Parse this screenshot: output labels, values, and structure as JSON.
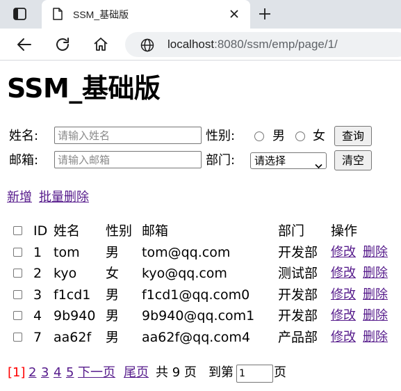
{
  "browser": {
    "tab_title": "SSM_基础版",
    "url_host": "localhost",
    "url_path": ":8080/ssm/emp/page/1/"
  },
  "page": {
    "title": "SSM_基础版",
    "search": {
      "name_label": "姓名:",
      "name_placeholder": "请输入姓名",
      "gender_label": "性别:",
      "gender_male": "男",
      "gender_female": "女",
      "query_button": "查询",
      "email_label": "邮箱:",
      "email_placeholder": "请输入邮箱",
      "dept_label": "部门:",
      "dept_selected": "请选择",
      "clear_button": "清空"
    },
    "actions": {
      "add": "新增",
      "batch_delete": "批量删除"
    },
    "table": {
      "headers": [
        "ID",
        "姓名",
        "性别",
        "邮箱",
        "部门",
        "操作"
      ],
      "edit_label": "修改",
      "delete_label": "删除",
      "rows": [
        {
          "id": "1",
          "name": "tom",
          "gender": "男",
          "email": "tom@qq.com",
          "dept": "开发部"
        },
        {
          "id": "2",
          "name": "kyo",
          "gender": "女",
          "email": "kyo@qq.com",
          "dept": "测试部"
        },
        {
          "id": "3",
          "name": "f1cd1",
          "gender": "男",
          "email": "f1cd1@qq.com0",
          "dept": "开发部"
        },
        {
          "id": "4",
          "name": "9b940",
          "gender": "男",
          "email": "9b940@qq.com1",
          "dept": "开发部"
        },
        {
          "id": "7",
          "name": "aa62f",
          "gender": "男",
          "email": "aa62f@qq.com4",
          "dept": "产品部"
        }
      ]
    },
    "pagination": {
      "current": "[1]",
      "pages": [
        "2",
        "3",
        "4",
        "5"
      ],
      "next": "下一页",
      "last": "尾页",
      "total_text": "共 9 页",
      "goto_label": "到第",
      "goto_value": "1",
      "page_suffix": "页"
    }
  }
}
